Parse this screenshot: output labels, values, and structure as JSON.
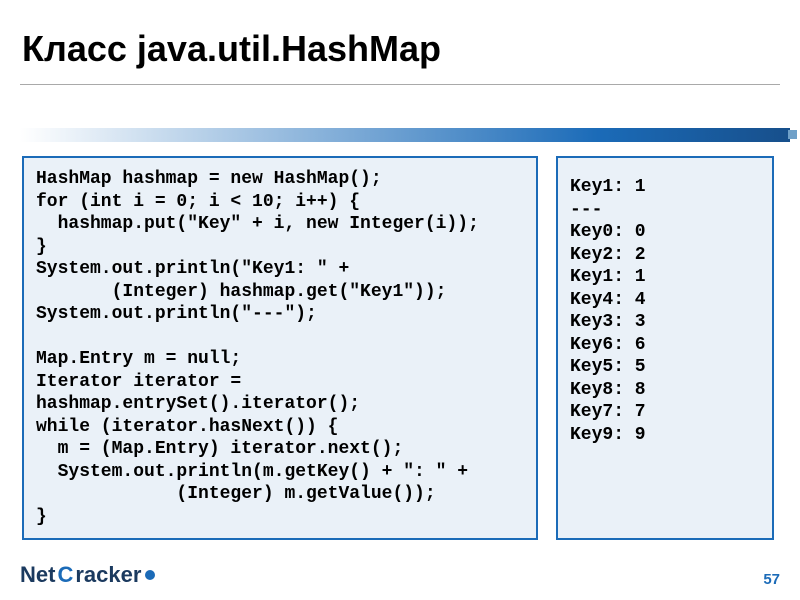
{
  "title": "Класс java.util.HashMap",
  "code_left": "HashMap hashmap = new HashMap();\nfor (int i = 0; i < 10; i++) {\n  hashmap.put(\"Key\" + i, new Integer(i));\n}\nSystem.out.println(\"Key1: \" +\n       (Integer) hashmap.get(\"Key1\"));\nSystem.out.println(\"---\");\n\nMap.Entry m = null;\nIterator iterator =\nhashmap.entrySet().iterator();\nwhile (iterator.hasNext()) {\n  m = (Map.Entry) iterator.next();\n  System.out.println(m.getKey() + \": \" +\n             (Integer) m.getValue());\n}",
  "code_right": "Key1: 1\n---\nKey0: 0\nKey2: 2\nKey1: 1\nKey4: 4\nKey3: 3\nKey6: 6\nKey5: 5\nKey8: 8\nKey7: 7\nKey9: 9",
  "logo_net": "Net",
  "logo_cracker": "racker",
  "logo_c": "C",
  "page_number": "57"
}
